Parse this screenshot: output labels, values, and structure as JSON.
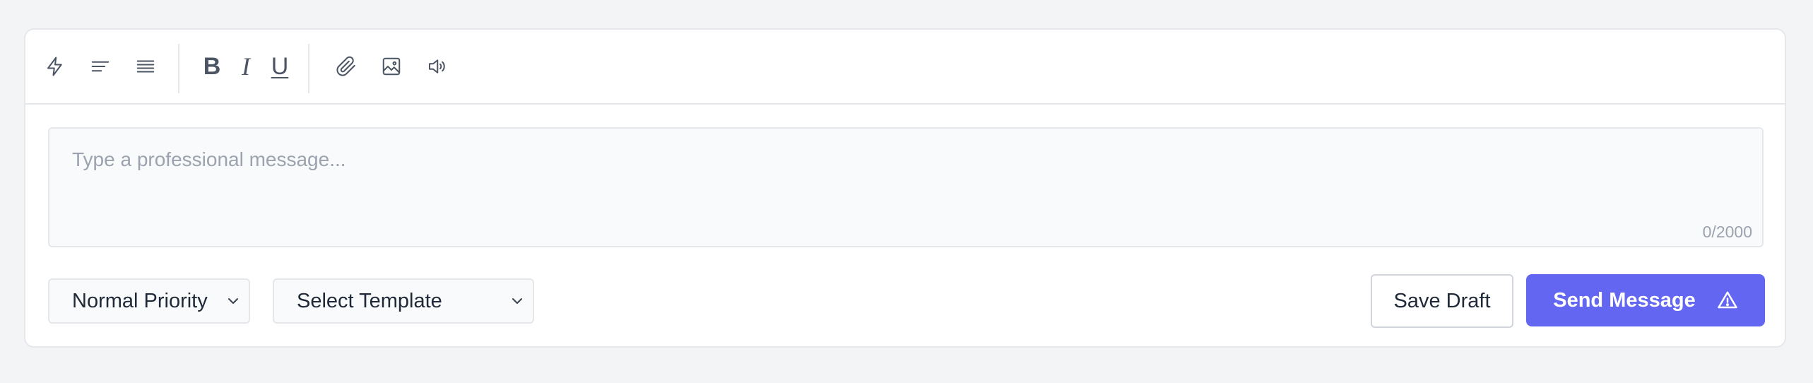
{
  "toolbar": {
    "items": [
      {
        "name": "quick-actions",
        "icon": "lightning-icon"
      },
      {
        "name": "align-left",
        "icon": "align-left-icon"
      },
      {
        "name": "align-justify",
        "icon": "align-justify-icon"
      },
      {
        "name": "bold",
        "label": "B"
      },
      {
        "name": "italic",
        "label": "I"
      },
      {
        "name": "underline",
        "label": "U"
      },
      {
        "name": "attach",
        "icon": "paperclip-icon"
      },
      {
        "name": "image",
        "icon": "image-icon"
      },
      {
        "name": "audio",
        "icon": "speaker-icon"
      }
    ],
    "bold_label": "B",
    "italic_label": "I",
    "underline_label": "U"
  },
  "editor": {
    "placeholder": "Type a professional message...",
    "value": "",
    "char_count": "0/2000"
  },
  "footer": {
    "priority": {
      "selected": "Normal Priority"
    },
    "template": {
      "selected": "Select Template"
    },
    "save_draft_label": "Save Draft",
    "send_label": "Send Message",
    "send_icon": "warning-triangle-icon"
  },
  "colors": {
    "accent": "#6366f1",
    "background": "#f3f4f6",
    "card": "#ffffff",
    "border": "#e5e7eb",
    "icon": "#4b5563",
    "placeholder": "#9ca3af"
  }
}
